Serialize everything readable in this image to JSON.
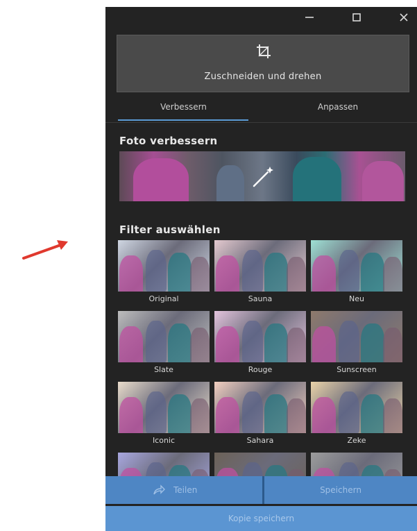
{
  "window": {
    "controls": [
      "minimize-icon",
      "maximize-icon",
      "close-icon"
    ]
  },
  "crop": {
    "label": "Zuschneiden und drehen",
    "icon": "crop-rotate-icon"
  },
  "tabs": [
    {
      "label": "Verbessern",
      "selected": true
    },
    {
      "label": "Anpassen",
      "selected": false
    }
  ],
  "enhance": {
    "heading": "Foto verbessern",
    "icon": "magic-wand-icon"
  },
  "filters": {
    "heading": "Filter auswählen",
    "items": [
      {
        "label": "Original",
        "tint": "#cfd6e2"
      },
      {
        "label": "Sauna",
        "tint": "#e4c9cf"
      },
      {
        "label": "Neu",
        "tint": "#9ee0d4"
      },
      {
        "label": "Slate",
        "tint": "#bdbdbd"
      },
      {
        "label": "Rouge",
        "tint": "#e3c3dc"
      },
      {
        "label": "Sunscreen",
        "tint": "#8f7a6c"
      },
      {
        "label": "Iconic",
        "tint": "#e9dccb"
      },
      {
        "label": "Sahara",
        "tint": "#f2cfc0"
      },
      {
        "label": "Zeke",
        "tint": "#e9d2a8"
      },
      {
        "label": "",
        "tint": "#a8a7df"
      },
      {
        "label": "",
        "tint": "#6c6258"
      },
      {
        "label": "",
        "tint": "#9c9c9c"
      }
    ]
  },
  "actions": {
    "share_label": "Teilen",
    "share_icon": "share-icon",
    "save_label": "Speichern",
    "copy_label": "Kopie speichern"
  },
  "colors": {
    "panel": "#232323",
    "accent": "#5b9bd5",
    "action_bar": "#4e86c4",
    "annotation_arrow": "#e0392e"
  }
}
